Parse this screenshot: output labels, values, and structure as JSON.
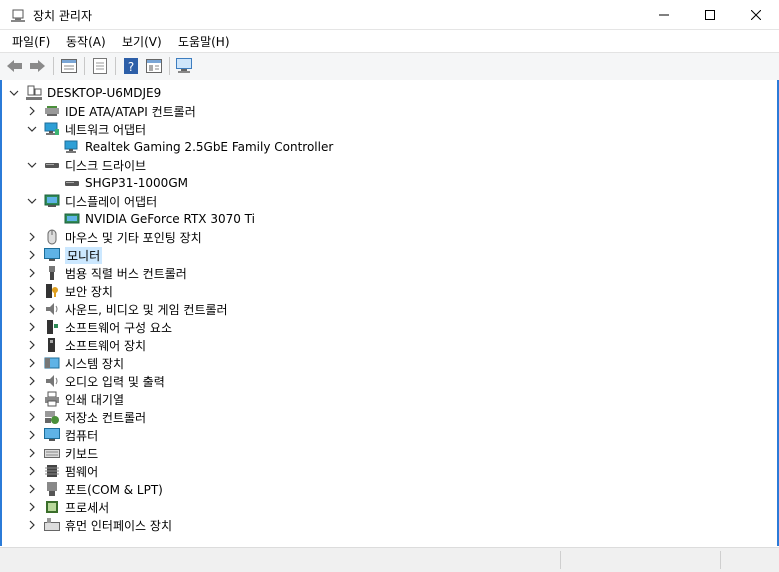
{
  "window": {
    "title": "장치 관리자"
  },
  "menu": [
    "파일(F)",
    "동작(A)",
    "보기(V)",
    "도움말(H)"
  ],
  "toolbar": [
    {
      "icon": "back-arrow-icon"
    },
    {
      "icon": "forward-arrow-icon"
    },
    {
      "icon": "properties-icon"
    },
    {
      "icon": "document-icon"
    },
    {
      "icon": "help-icon"
    },
    {
      "icon": "panel-icon"
    },
    {
      "icon": "monitor-scan-icon"
    }
  ],
  "tree": {
    "root": "DESKTOP-U6MDJE9",
    "nodes": [
      {
        "label": "IDE ATA/ATAPI 컨트롤러",
        "icon": "ide-controller-icon",
        "expanded": false
      },
      {
        "label": "네트워크 어댑터",
        "icon": "network-adapter-icon",
        "expanded": true,
        "children": [
          "Realtek Gaming 2.5GbE Family Controller"
        ]
      },
      {
        "label": "디스크 드라이브",
        "icon": "disk-drive-icon",
        "expanded": true,
        "children": [
          "SHGP31-1000GM"
        ]
      },
      {
        "label": "디스플레이 어댑터",
        "icon": "display-adapter-icon",
        "expanded": true,
        "children": [
          "NVIDIA GeForce RTX 3070 Ti"
        ]
      },
      {
        "label": "마우스 및 기타 포인팅 장치",
        "icon": "mouse-icon",
        "expanded": false
      },
      {
        "label": "모니터",
        "icon": "monitor-icon",
        "expanded": false,
        "selected": true
      },
      {
        "label": "범용 직렬 버스 컨트롤러",
        "icon": "usb-icon",
        "expanded": false
      },
      {
        "label": "보안 장치",
        "icon": "security-device-icon",
        "expanded": false
      },
      {
        "label": "사운드, 비디오 및 게임 컨트롤러",
        "icon": "sound-icon",
        "expanded": false
      },
      {
        "label": "소프트웨어 구성 요소",
        "icon": "software-component-icon",
        "expanded": false
      },
      {
        "label": "소프트웨어 장치",
        "icon": "software-device-icon",
        "expanded": false
      },
      {
        "label": "시스템 장치",
        "icon": "system-device-icon",
        "expanded": false
      },
      {
        "label": "오디오 입력 및 출력",
        "icon": "audio-io-icon",
        "expanded": false
      },
      {
        "label": "인쇄 대기열",
        "icon": "printer-icon",
        "expanded": false
      },
      {
        "label": "저장소 컨트롤러",
        "icon": "storage-controller-icon",
        "expanded": false
      },
      {
        "label": "컴퓨터",
        "icon": "computer-icon",
        "expanded": false
      },
      {
        "label": "키보드",
        "icon": "keyboard-icon",
        "expanded": false
      },
      {
        "label": "펌웨어",
        "icon": "firmware-icon",
        "expanded": false
      },
      {
        "label": "포트(COM & LPT)",
        "icon": "port-icon",
        "expanded": false
      },
      {
        "label": "프로세서",
        "icon": "processor-icon",
        "expanded": false
      },
      {
        "label": "휴먼 인터페이스 장치",
        "icon": "hid-icon",
        "expanded": false
      }
    ]
  },
  "colors": {
    "selection": "#cce8ff",
    "accent": "#2b7bd8"
  }
}
